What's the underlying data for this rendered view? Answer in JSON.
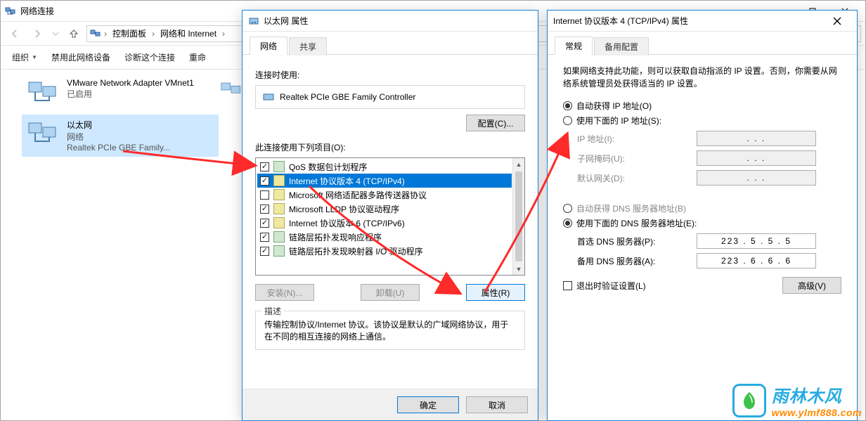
{
  "explorer": {
    "title": "网络连接",
    "breadcrumb": {
      "seg1": "控制面板",
      "seg2": "网络和 Internet"
    },
    "cmdbar": {
      "organize": "组织",
      "disable": "禁用此网络设备",
      "diagnose": "诊断这个连接",
      "rename_prefix": "重命"
    },
    "items": [
      {
        "title": "VMware Network Adapter VMnet1",
        "sub1": "已启用",
        "sub2": ""
      },
      {
        "title": "以太网",
        "sub1": "网络",
        "sub2": "Realtek PCIe GBE Family..."
      }
    ]
  },
  "eth_dialog": {
    "title": "以太网 属性",
    "tabs": {
      "network": "网络",
      "share": "共享"
    },
    "connect_using": "连接时使用:",
    "adapter": "Realtek PCIe GBE Family Controller",
    "configure_btn": "配置(C)...",
    "items_label": "此连接使用下列项目(O):",
    "protocols": [
      {
        "checked": true,
        "type": "svc",
        "label": "QoS 数据包计划程序"
      },
      {
        "checked": true,
        "type": "proto",
        "label": "Internet 协议版本 4 (TCP/IPv4)",
        "selected": true
      },
      {
        "checked": false,
        "type": "proto",
        "label": "Microsoft 网络适配器多路传送器协议"
      },
      {
        "checked": true,
        "type": "proto",
        "label": "Microsoft LLDP 协议驱动程序"
      },
      {
        "checked": true,
        "type": "proto",
        "label": "Internet 协议版本 6 (TCP/IPv6)"
      },
      {
        "checked": true,
        "type": "svc",
        "label": "链路层拓扑发现响应程序"
      },
      {
        "checked": true,
        "type": "svc",
        "label": "链路层拓扑发现映射器 I/O 驱动程序"
      }
    ],
    "install_btn": "安装(N)...",
    "uninstall_btn": "卸载(U)",
    "properties_btn": "属性(R)",
    "desc_legend": "描述",
    "desc_text": "传输控制协议/Internet 协议。该协议是默认的广域网络协议，用于在不同的相互连接的网络上通信。",
    "ok": "确定",
    "cancel": "取消"
  },
  "ip_dialog": {
    "title": "Internet 协议版本 4 (TCP/IPv4) 属性",
    "tabs": {
      "general": "常规",
      "alt": "备用配置"
    },
    "info": "如果网络支持此功能，则可以获取自动指派的 IP 设置。否则，你需要从网络系统管理员处获得适当的 IP 设置。",
    "auto_ip": "自动获得 IP 地址(O)",
    "manual_ip": "使用下面的 IP 地址(S):",
    "ip_label": "IP 地址(I):",
    "mask_label": "子网掩码(U):",
    "gw_label": "默认网关(D):",
    "auto_dns": "自动获得 DNS 服务器地址(B)",
    "manual_dns": "使用下面的 DNS 服务器地址(E):",
    "pref_dns_label": "首选 DNS 服务器(P):",
    "alt_dns_label": "备用 DNS 服务器(A):",
    "pref_dns_value": "223 .  5  .  5  .  5",
    "alt_dns_value": "223 .  6  .  6  .  6",
    "validate_on_exit": "退出时验证设置(L)",
    "advanced_btn": "高级(V)"
  },
  "watermark": {
    "cn": "雨林木风",
    "url": "www.ylmf888.com"
  },
  "dots": ".       .       ."
}
